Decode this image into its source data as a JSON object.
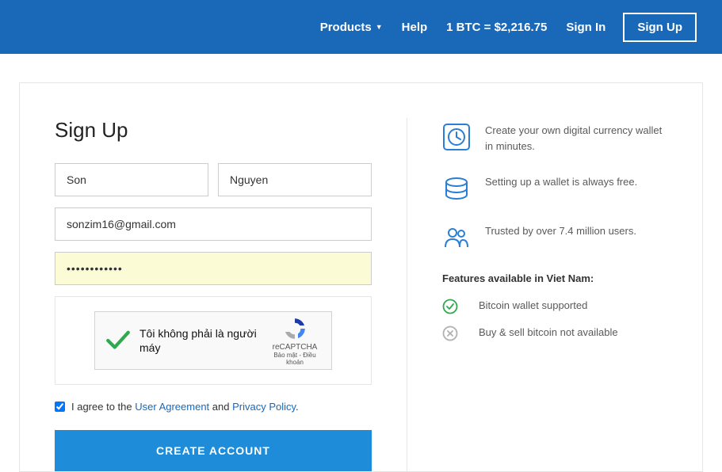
{
  "header": {
    "products": "Products",
    "help": "Help",
    "rate": "1 BTC = $2,216.75",
    "signin": "Sign In",
    "signup": "Sign Up"
  },
  "form": {
    "title": "Sign Up",
    "firstname": "Son",
    "lastname": "Nguyen",
    "email": "sonzim16@gmail.com",
    "password": "••••••••••••",
    "recaptcha_text": "Tôi không phải là người máy",
    "recaptcha_brand": "reCAPTCHA",
    "recaptcha_terms": "Bảo mật - Điều khoản",
    "agree_prefix": "I agree to the ",
    "agree_link1": "User Agreement",
    "agree_mid": " and ",
    "agree_link2": "Privacy Policy",
    "agree_suffix": ".",
    "submit": "CREATE ACCOUNT"
  },
  "info": {
    "items": [
      {
        "text": "Create your own digital currency wallet in minutes."
      },
      {
        "text": "Setting up a wallet is always free."
      },
      {
        "text": "Trusted by over 7.4 million users."
      }
    ],
    "features_title": "Features available in Viet Nam:",
    "features": [
      {
        "text": "Bitcoin wallet supported",
        "ok": true
      },
      {
        "text": "Buy & sell bitcoin not available",
        "ok": false
      }
    ]
  }
}
